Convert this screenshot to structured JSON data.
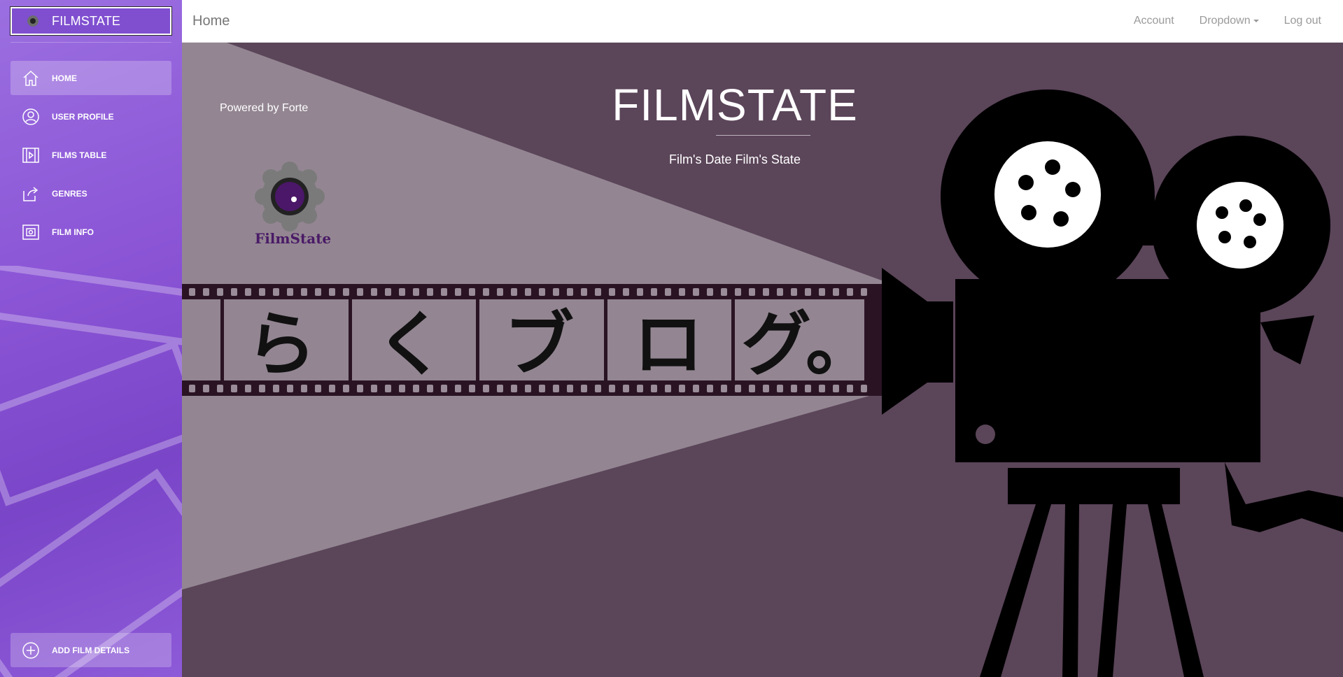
{
  "brand": {
    "title": "FILMSTATE",
    "logo_icon": "camera-lens-icon"
  },
  "sidebar": {
    "items": [
      {
        "label": "HOME",
        "icon": "home-icon",
        "active": true
      },
      {
        "label": "USER PROFILE",
        "icon": "user-icon",
        "active": false
      },
      {
        "label": "FILMS TABLE",
        "icon": "film-table-icon",
        "active": false
      },
      {
        "label": "GENRES",
        "icon": "share-icon",
        "active": false
      },
      {
        "label": "FILM INFO",
        "icon": "film-info-icon",
        "active": false
      }
    ],
    "add_button": {
      "label": "ADD FILM DETAILS",
      "icon": "plus-circle-icon"
    }
  },
  "topbar": {
    "title": "Home",
    "links": {
      "account": "Account",
      "dropdown": "Dropdown",
      "logout": "Log out"
    }
  },
  "hero": {
    "powered_by": "Powered by Forte",
    "logo_text": "FilmState",
    "title": "FILMSTATE",
    "subtitle": "Film's Date Film's State",
    "film_strip_text": [
      "ら",
      "く",
      "ブ",
      "ロ",
      "グ。"
    ]
  },
  "colors": {
    "sidebar_accent": "#8b55d6",
    "hero_background": "#5b4559",
    "light_beam": "#938692"
  }
}
